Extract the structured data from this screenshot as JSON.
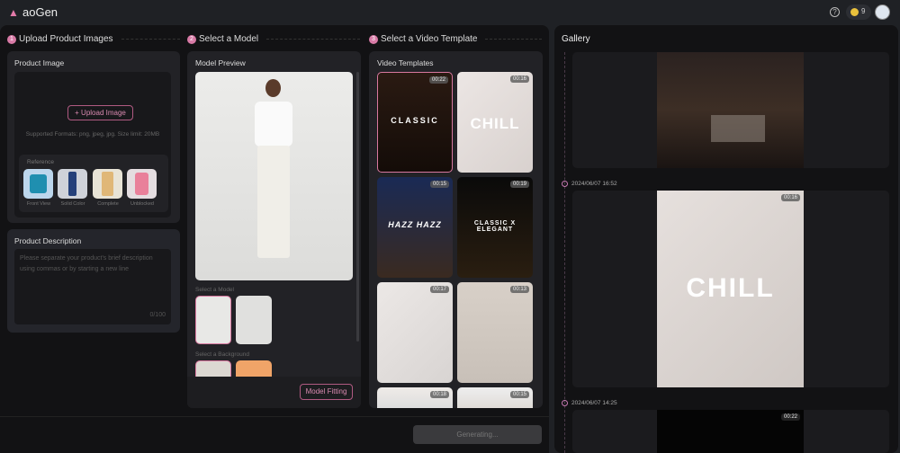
{
  "app": {
    "title": "aoGen",
    "credits": "9"
  },
  "steps": [
    {
      "num": "1",
      "label": "Upload Product Images"
    },
    {
      "num": "2",
      "label": "Select a Model"
    },
    {
      "num": "3",
      "label": "Select a Video Template"
    }
  ],
  "product_image": {
    "title": "Product Image",
    "upload_label": "+ Upload Image",
    "formats": "Supported Formats: png, jpeg, jpg. Size limit: 20MB",
    "reference_title": "Reference",
    "references": [
      {
        "label": "Front View"
      },
      {
        "label": "Solid Color"
      },
      {
        "label": "Complete"
      },
      {
        "label": "Unblocked"
      }
    ]
  },
  "product_description": {
    "title": "Product Description",
    "placeholder": "Please separate your product's brief description using commas or by starting a new line",
    "counter": "0/100"
  },
  "model": {
    "title": "Model Preview",
    "select_model": "Select a Model",
    "select_background": "Select a Background",
    "fitting_button": "Model Fitting"
  },
  "templates": {
    "title": "Video Templates",
    "items": [
      {
        "duration": "00:22",
        "text": "CLASSIC"
      },
      {
        "duration": "00:16",
        "text": "CHILL"
      },
      {
        "duration": "00:15",
        "text": "HAZZ HAZZ"
      },
      {
        "duration": "00:19",
        "text": "CLASSIC X ELEGANT"
      },
      {
        "duration": "00:17",
        "text": ""
      },
      {
        "duration": "00:13",
        "text": ""
      },
      {
        "duration": "00:18",
        "text": ""
      },
      {
        "duration": "00:15",
        "text": ""
      }
    ]
  },
  "generate_button": "Generating...",
  "gallery": {
    "title": "Gallery",
    "items": [
      {
        "timestamp": "",
        "duration": "",
        "text": ""
      },
      {
        "timestamp": "2024/06/07 16:52",
        "duration": "00:16",
        "text": "CHILL"
      },
      {
        "timestamp": "2024/06/07 14:25",
        "duration": "00:22",
        "text": ""
      }
    ]
  },
  "colors": {
    "accent": "#d87aa6",
    "background": "#121214"
  }
}
